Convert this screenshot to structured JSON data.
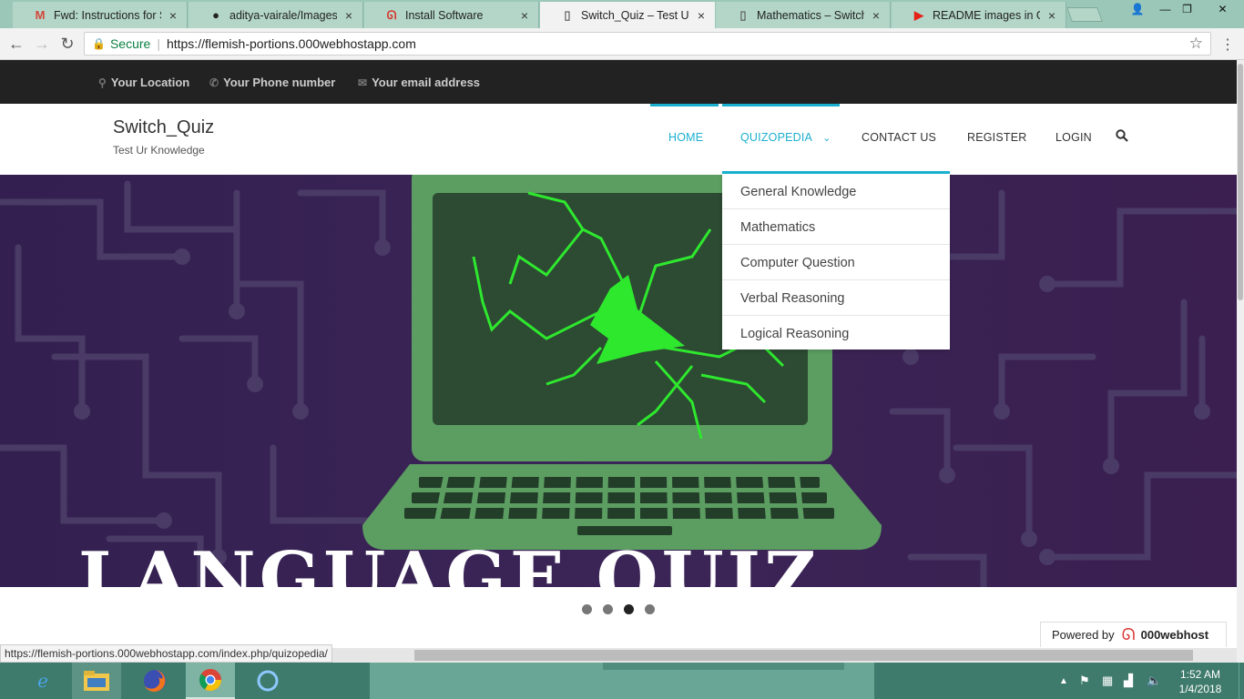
{
  "browser": {
    "tabs": [
      {
        "title": "Fwd: Instructions for Sub",
        "icon": "gmail-icon",
        "icon_glyph": "M",
        "icon_color": "#d44638"
      },
      {
        "title": "aditya-vairale/Images-in",
        "icon": "github-icon",
        "icon_glyph": "●",
        "icon_color": "#222222"
      },
      {
        "title": "Install Software",
        "icon": "000webhost-icon",
        "icon_glyph": "ᘏ",
        "icon_color": "#d9342b"
      },
      {
        "title": "Switch_Quiz – Test Ur Kn",
        "icon": "page-icon",
        "icon_glyph": "▯",
        "icon_color": "#666666"
      },
      {
        "title": "Mathematics – Switch_Q",
        "icon": "page-icon",
        "icon_glyph": "▯",
        "icon_color": "#666666"
      },
      {
        "title": "README images in Githu",
        "icon": "youtube-icon",
        "icon_glyph": "▶",
        "icon_color": "#e62117"
      }
    ],
    "active_tab": 3,
    "tab_close": "×",
    "address": {
      "secure_label": "Secure",
      "url": "https://flemish-portions.000webhostapp.com"
    },
    "status_url": "https://flemish-portions.000webhostapp.com/index.php/quizopedia/"
  },
  "site": {
    "topbar": {
      "location": "Your Location",
      "phone": "Your Phone number",
      "email": "Your email address"
    },
    "title": "Switch_Quiz",
    "tagline": "Test Ur Knowledge",
    "nav": [
      {
        "label": "HOME"
      },
      {
        "label": "QUIZOPEDIA",
        "caret": "⌄"
      },
      {
        "label": "CONTACT US"
      },
      {
        "label": "REGISTER"
      },
      {
        "label": "LOGIN"
      }
    ],
    "dropdown": [
      "General Knowledge",
      "Mathematics",
      "Computer Question",
      "Verbal Reasoning",
      "Logical Reasoning"
    ],
    "hero_caption": "LANGUAGE QUIZ",
    "slider": {
      "count": 4,
      "active": 3
    },
    "powered_by": {
      "label": "Powered by",
      "brand": "000webhost"
    }
  },
  "taskbar": {
    "clock_time": "1:52 AM",
    "clock_date": "1/4/2018"
  },
  "colors": {
    "accent": "#1aafcf",
    "hero_bg": "#3a2358",
    "laptop_green": "#5c9d62",
    "crack_green": "#2ee82e"
  }
}
